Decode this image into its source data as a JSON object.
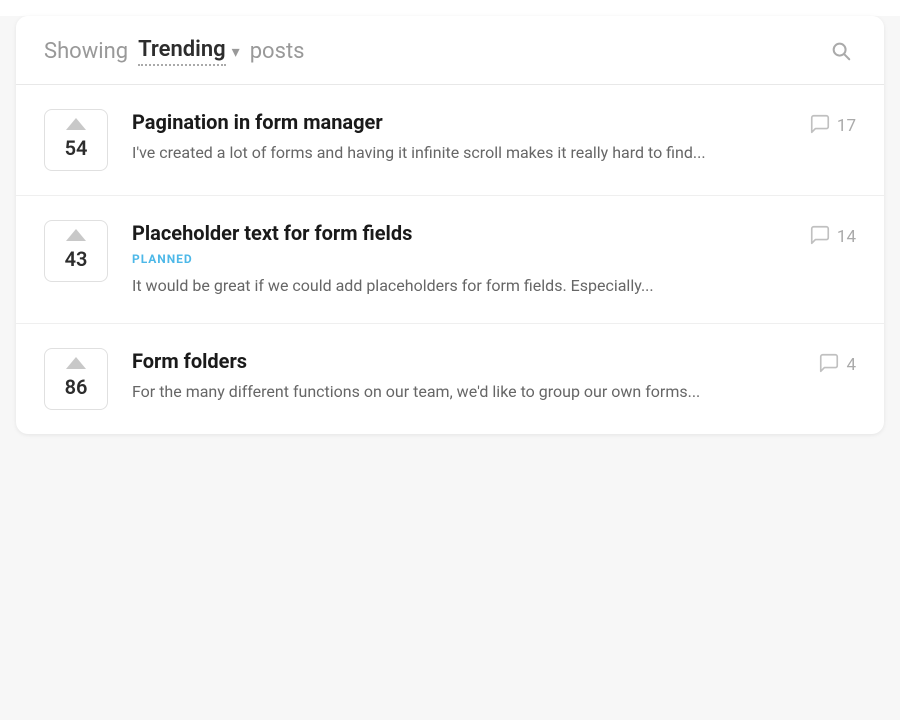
{
  "header": {
    "showing_label": "Showing",
    "dropdown_label": "Trending",
    "posts_label": "posts"
  },
  "posts": [
    {
      "id": 1,
      "vote_count": "54",
      "title": "Pagination in form manager",
      "status": null,
      "excerpt": "I've created a lot of forms and having it infinite scroll makes it really hard to find...",
      "comment_count": "17"
    },
    {
      "id": 2,
      "vote_count": "43",
      "title": "Placeholder text for form fields",
      "status": "PLANNED",
      "excerpt": "It would be great if we could add placeholders for form fields. Especially...",
      "comment_count": "14"
    },
    {
      "id": 3,
      "vote_count": "86",
      "title": "Form folders",
      "status": null,
      "excerpt": "For the many different functions on our team, we'd like to group our own forms...",
      "comment_count": "4"
    }
  ]
}
